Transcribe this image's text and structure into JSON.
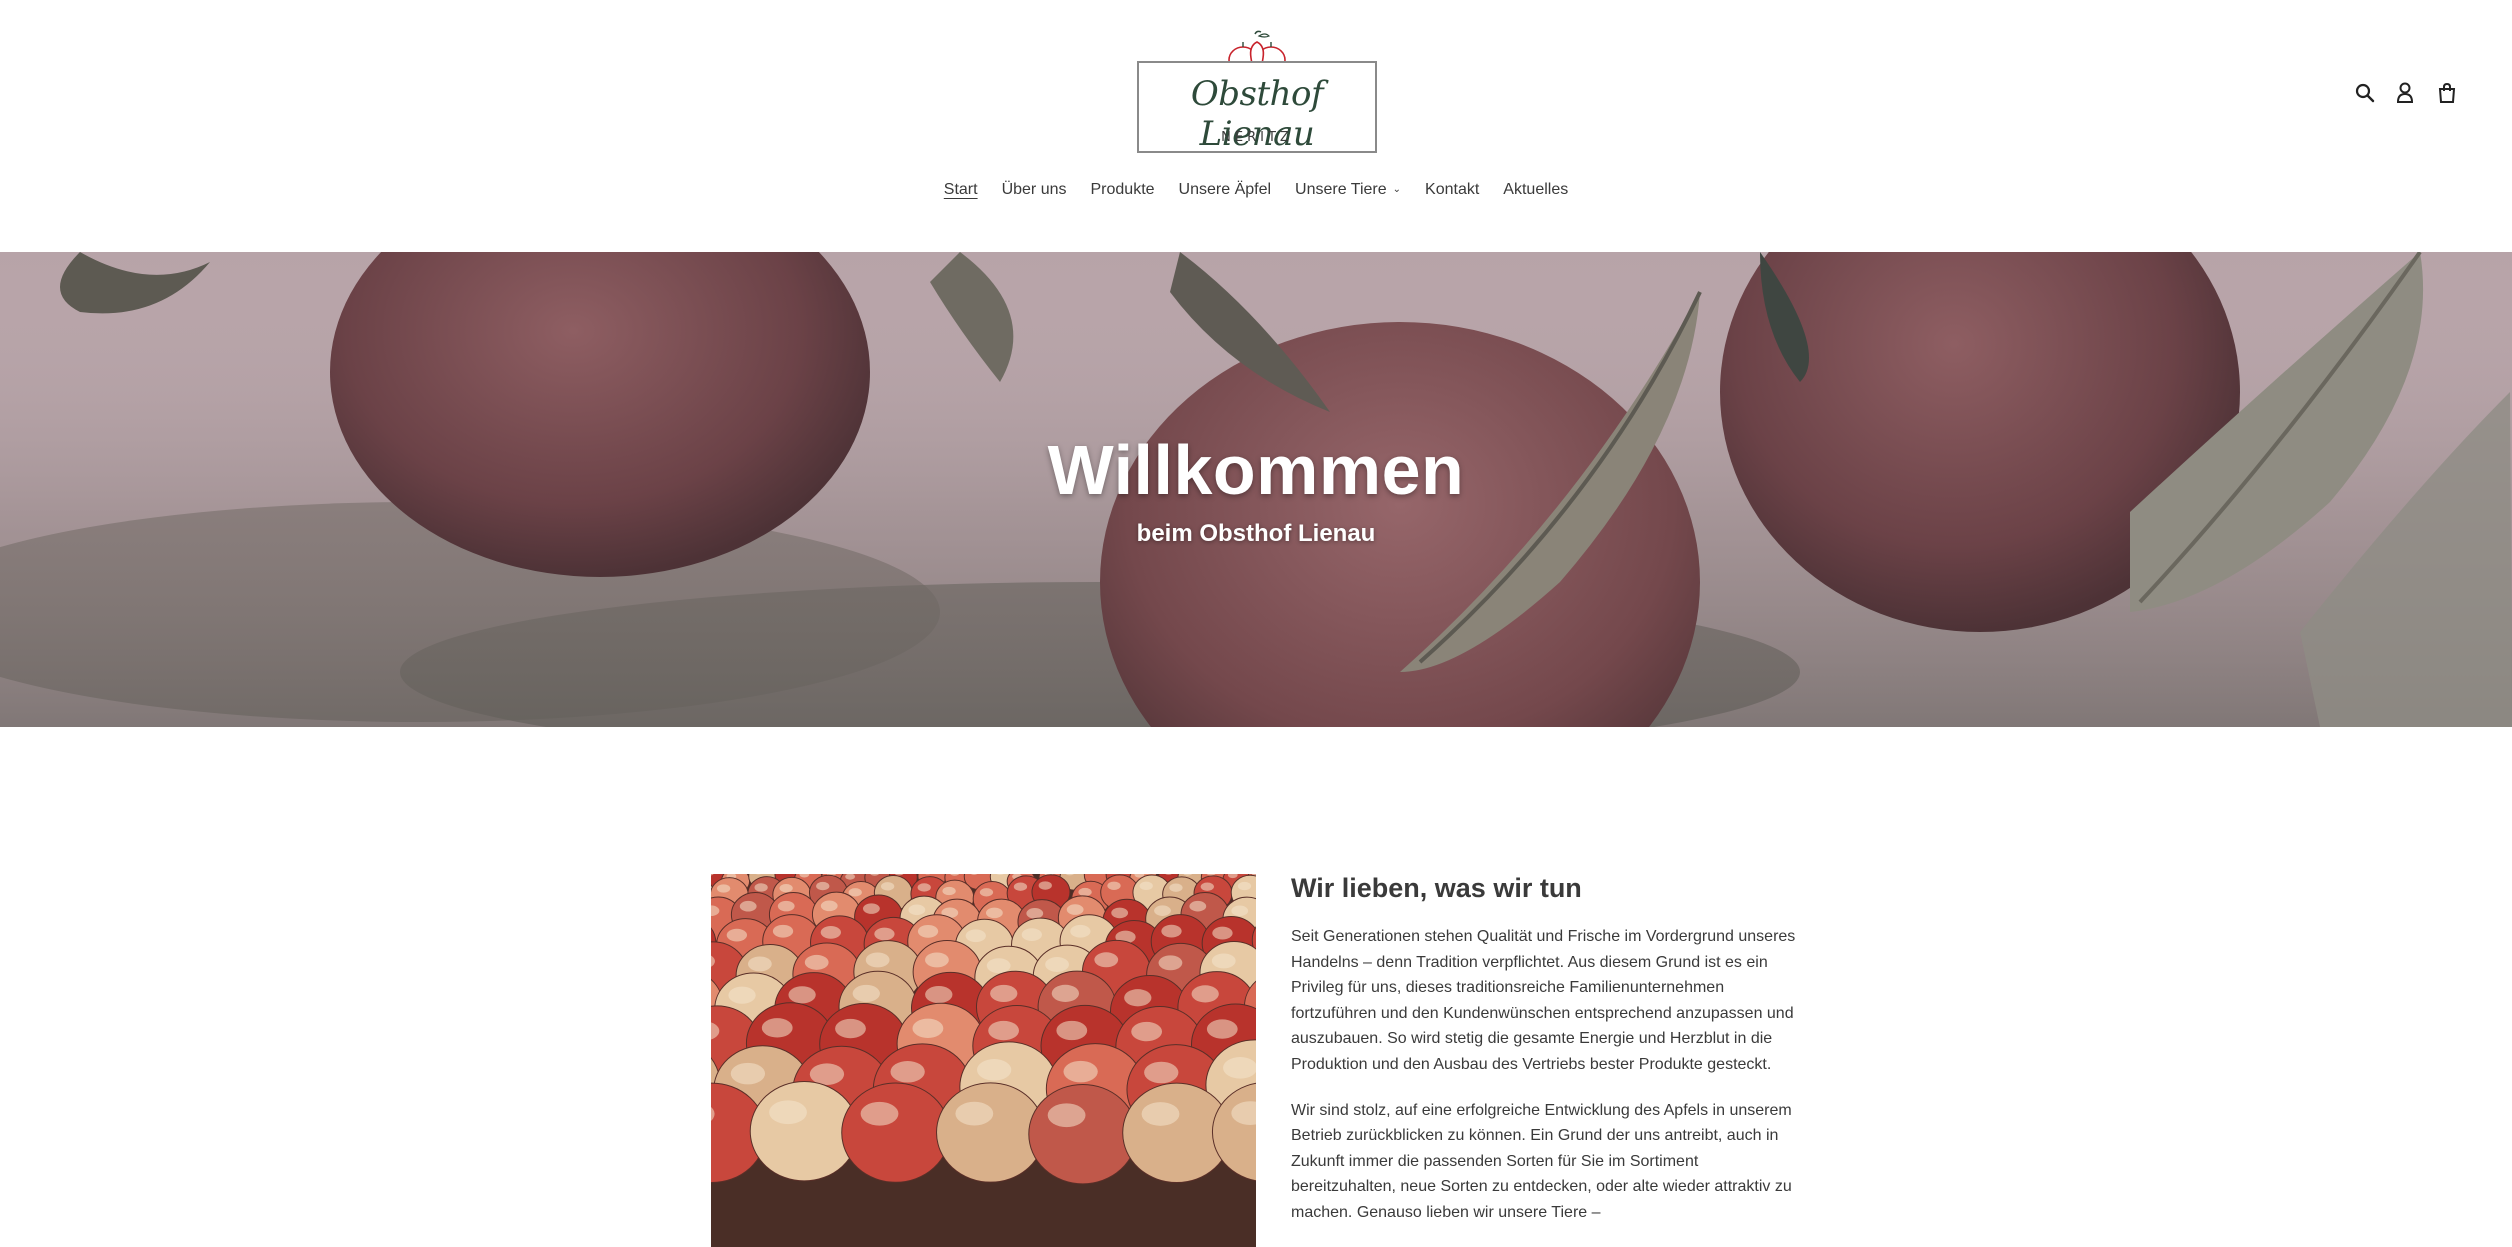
{
  "header": {
    "logo": {
      "name": "Obsthof Lienau",
      "subtitle": "NERITZ"
    },
    "icons": [
      "search-icon",
      "account-icon",
      "cart-icon"
    ]
  },
  "nav": {
    "items": [
      {
        "label": "Start",
        "active": true
      },
      {
        "label": "Über uns"
      },
      {
        "label": "Produkte"
      },
      {
        "label": "Unsere Äpfel"
      },
      {
        "label": "Unsere Tiere",
        "dropdown": true
      },
      {
        "label": "Kontakt"
      },
      {
        "label": "Aktuelles"
      }
    ]
  },
  "hero": {
    "title": "Willkommen",
    "subtitle": "beim Obsthof Lienau"
  },
  "feature": {
    "title": "Wir lieben, was wir tun",
    "paragraphs": [
      "Seit Generationen stehen Qualität und Frische im Vordergrund unseres Handelns – denn Tradition verpflichtet. Aus diesem Grund ist es ein Privileg für uns, dieses traditionsreiche Familienunternehmen fortzuführen und den Kundenwünschen entsprechend anzupassen und auszubauen. So wird stetig die gesamte Energie und Herzblut in die Produktion und den Ausbau des Vertriebs bester Produkte gesteckt.",
      "Wir sind stolz, auf eine erfolgreiche Entwicklung des Apfels in unserem Betrieb zurückblicken zu können. Ein Grund der uns antreibt, auch in Zukunft immer die passenden Sorten für Sie im Sortiment bereitzuhalten, neue Sorten zu entdecken, oder alte wieder attraktiv zu machen. Genauso lieben wir unsere Tiere –"
    ]
  },
  "colors": {
    "text": "#3a3a3a",
    "logo_green": "#2e4a3a",
    "logo_heart": "#c8232c",
    "hero_text": "#ffffff"
  }
}
